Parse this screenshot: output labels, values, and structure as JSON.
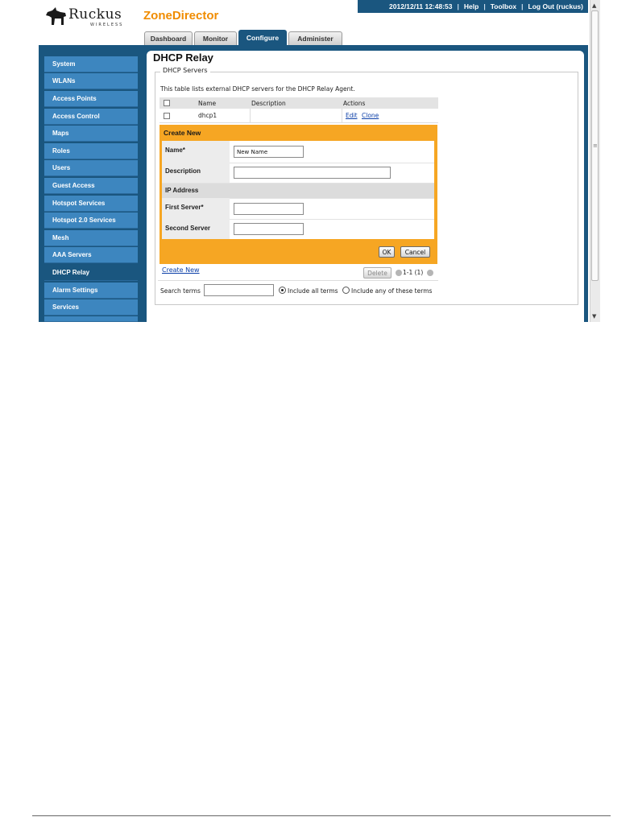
{
  "brand": {
    "logo_text": "Ruckus",
    "logo_sub": "WIRELESS",
    "product": "ZoneDirector"
  },
  "topbar": {
    "datetime": "2012/12/11  12:48:53",
    "help": "Help",
    "toolbox": "Toolbox",
    "logout": "Log Out (ruckus)",
    "separator": "|"
  },
  "tabs": [
    {
      "label": "Dashboard"
    },
    {
      "label": "Monitor"
    },
    {
      "label": "Configure",
      "active": true
    },
    {
      "label": "Administer"
    }
  ],
  "sidebar": {
    "items": [
      {
        "label": "System"
      },
      {
        "label": "WLANs"
      },
      {
        "label": "Access Points"
      },
      {
        "label": "Access Control"
      },
      {
        "label": "Maps"
      },
      {
        "label": "Roles"
      },
      {
        "label": "Users"
      },
      {
        "label": "Guest Access"
      },
      {
        "label": "Hotspot Services"
      },
      {
        "label": "Hotspot 2.0 Services"
      },
      {
        "label": "Mesh"
      },
      {
        "label": "AAA Servers"
      },
      {
        "label": "DHCP Relay",
        "active": true
      },
      {
        "label": "Alarm Settings"
      },
      {
        "label": "Services"
      }
    ]
  },
  "page": {
    "title": "DHCP Relay",
    "section": "DHCP Servers",
    "description": "This table lists external DHCP servers for the DHCP Relay Agent."
  },
  "table": {
    "columns": [
      "Name",
      "Description",
      "Actions"
    ],
    "rows": [
      {
        "name": "dhcp1",
        "description": "",
        "actions": [
          "Edit",
          "Clone"
        ]
      }
    ]
  },
  "form": {
    "title": "Create New",
    "name_label": "Name*",
    "name_value": "New Name",
    "description_label": "Description",
    "description_value": "",
    "ip_section": "IP Address",
    "first_server_label": "First Server*",
    "first_server_value": "",
    "second_server_label": "Second Server",
    "second_server_value": "",
    "ok": "OK",
    "cancel": "Cancel"
  },
  "footer": {
    "create_new": "Create New",
    "delete": "Delete",
    "pagination": "1-1 (1)",
    "search_label": "Search terms",
    "search_value": "",
    "opt_all": "Include all terms",
    "opt_any": "Include any of these terms",
    "selected_option": "all"
  },
  "colors": {
    "nav_blue": "#3d86bf",
    "dark_blue": "#1a567f",
    "accent_orange": "#f6a623",
    "brand_orange": "#f08c00"
  }
}
